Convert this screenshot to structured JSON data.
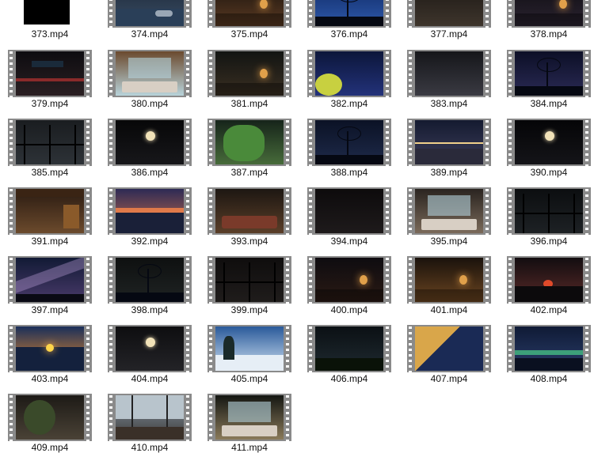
{
  "files": [
    {
      "name": "373.mp4",
      "colors": [
        "#000000",
        "#000000"
      ],
      "art": "none",
      "frame": false
    },
    {
      "name": "374.mp4",
      "colors": [
        "#1d2a3a",
        "#3a4c63"
      ],
      "art": "sea"
    },
    {
      "name": "375.mp4",
      "colors": [
        "#1a130e",
        "#5a3a22"
      ],
      "art": "room-warm"
    },
    {
      "name": "376.mp4",
      "colors": [
        "#0f2a66",
        "#2d57a8"
      ],
      "art": "tree-night"
    },
    {
      "name": "377.mp4",
      "colors": [
        "#1b1714",
        "#3e352c"
      ],
      "art": "room-dark"
    },
    {
      "name": "378.mp4",
      "colors": [
        "#0f0d12",
        "#2a2330"
      ],
      "art": "room-lamp"
    },
    {
      "name": "379.mp4",
      "colors": [
        "#0d0c10",
        "#2a1f22"
      ],
      "art": "bar"
    },
    {
      "name": "380.mp4",
      "colors": [
        "#6b4a2e",
        "#b8d3da"
      ],
      "art": "window-bed"
    },
    {
      "name": "381.mp4",
      "colors": [
        "#121412",
        "#3a2f22"
      ],
      "art": "room-fire"
    },
    {
      "name": "382.mp4",
      "colors": [
        "#0c163a",
        "#23327a"
      ],
      "art": "stars-leaves"
    },
    {
      "name": "383.mp4",
      "colors": [
        "#15161a",
        "#3a3a42"
      ],
      "art": "room-dark"
    },
    {
      "name": "384.mp4",
      "colors": [
        "#0c0f26",
        "#2a2a55"
      ],
      "art": "trees-dusk"
    },
    {
      "name": "385.mp4",
      "colors": [
        "#1a1d20",
        "#2d3237"
      ],
      "art": "window-rain"
    },
    {
      "name": "386.mp4",
      "colors": [
        "#070708",
        "#17171a"
      ],
      "art": "moon-clouds"
    },
    {
      "name": "387.mp4",
      "colors": [
        "#16241a",
        "#476b3a"
      ],
      "art": "green-window"
    },
    {
      "name": "388.mp4",
      "colors": [
        "#0b1225",
        "#1e2a4a"
      ],
      "art": "trees-night"
    },
    {
      "name": "389.mp4",
      "colors": [
        "#141a30",
        "#3d3e5a"
      ],
      "art": "deck-night"
    },
    {
      "name": "390.mp4",
      "colors": [
        "#050507",
        "#141418"
      ],
      "art": "moon-dark"
    },
    {
      "name": "391.mp4",
      "colors": [
        "#2a1b12",
        "#6b4a2c"
      ],
      "art": "attic"
    },
    {
      "name": "392.mp4",
      "colors": [
        "#2d2a55",
        "#c86d4a"
      ],
      "art": "sunset-water"
    },
    {
      "name": "393.mp4",
      "colors": [
        "#1d1712",
        "#5a3e28"
      ],
      "art": "living-room"
    },
    {
      "name": "394.mp4",
      "colors": [
        "#0d0b0c",
        "#1e1a1b"
      ],
      "art": "room-dark"
    },
    {
      "name": "395.mp4",
      "colors": [
        "#2a2420",
        "#7a6a5a"
      ],
      "art": "bedroom"
    },
    {
      "name": "396.mp4",
      "colors": [
        "#0c0e10",
        "#1d2124"
      ],
      "art": "window-rain"
    },
    {
      "name": "397.mp4",
      "colors": [
        "#111a35",
        "#4a3a6a"
      ],
      "art": "milkyway"
    },
    {
      "name": "398.mp4",
      "colors": [
        "#0e1010",
        "#1f2323"
      ],
      "art": "forest-dark"
    },
    {
      "name": "399.mp4",
      "colors": [
        "#0f0d0d",
        "#1f1c1b"
      ],
      "art": "window-dark"
    },
    {
      "name": "400.mp4",
      "colors": [
        "#0e0c10",
        "#2a1a14"
      ],
      "art": "room-fire"
    },
    {
      "name": "401.mp4",
      "colors": [
        "#1a120c",
        "#6a4420"
      ],
      "art": "room-lamp"
    },
    {
      "name": "402.mp4",
      "colors": [
        "#120d10",
        "#5a2a28"
      ],
      "art": "red-sun"
    },
    {
      "name": "403.mp4",
      "colors": [
        "#1a2f5a",
        "#e88a2a"
      ],
      "art": "sunrise-sea"
    },
    {
      "name": "404.mp4",
      "colors": [
        "#0e0e10",
        "#232327"
      ],
      "art": "moon-branches"
    },
    {
      "name": "405.mp4",
      "colors": [
        "#2a5a9a",
        "#cfe1f2"
      ],
      "art": "snow"
    },
    {
      "name": "406.mp4",
      "colors": [
        "#0b1014",
        "#1f2a30"
      ],
      "art": "grass-stars"
    },
    {
      "name": "407.mp4",
      "colors": [
        "#1a2a55",
        "#d4a24a"
      ],
      "art": "tent"
    },
    {
      "name": "408.mp4",
      "colors": [
        "#0f1a35",
        "#2a3d6a"
      ],
      "art": "aurora"
    },
    {
      "name": "409.mp4",
      "colors": [
        "#1d1a16",
        "#4a4236"
      ],
      "art": "plants"
    },
    {
      "name": "410.mp4",
      "colors": [
        "#8a97a2",
        "#3a3a3a"
      ],
      "art": "panorama"
    },
    {
      "name": "411.mp4",
      "colors": [
        "#141612",
        "#8a7a5a"
      ],
      "art": "bedroom-window"
    }
  ]
}
